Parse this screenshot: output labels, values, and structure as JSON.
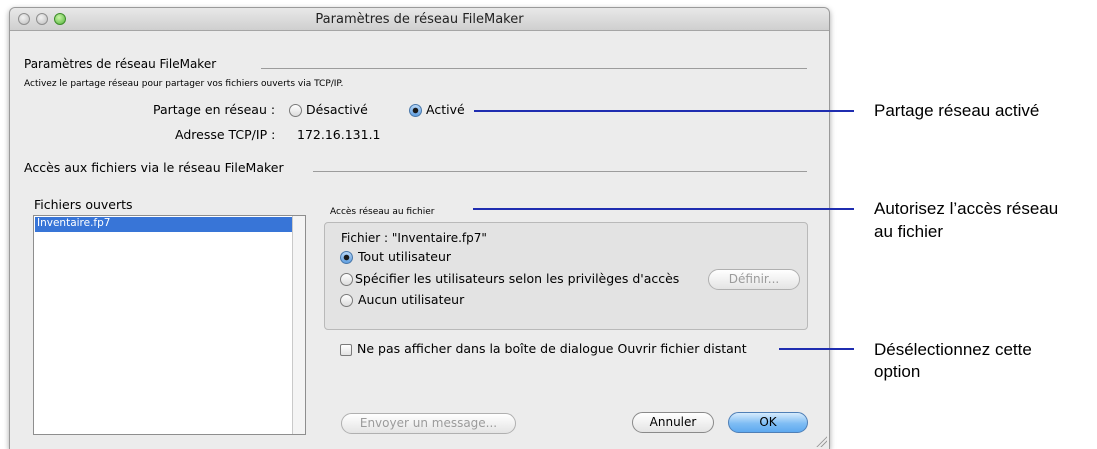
{
  "window": {
    "title": "Paramètres de réseau FileMaker"
  },
  "network": {
    "section_title": "Paramètres de réseau FileMaker",
    "description": "Activez le partage réseau pour partager vos fichiers ouverts via TCP/IP.",
    "sharing_label": "Partage en réseau :",
    "option_off": "Désactivé",
    "option_on": "Activé",
    "selected": "Activé",
    "tcpip_label": "Adresse TCP/IP :",
    "tcpip_value": "172.16.131.1"
  },
  "access": {
    "section_title": "Accès aux fichiers via le réseau FileMaker",
    "open_files_label": "Fichiers ouverts",
    "open_files": [
      "Inventaire.fp7"
    ],
    "file_access_label": "Accès réseau au fichier",
    "file_label": "Fichier : \"Inventaire.fp7\"",
    "options": [
      {
        "label": "Tout utilisateur",
        "selected": true
      },
      {
        "label": "Spécifier les utilisateurs selon les privilèges d'accès",
        "selected": false
      },
      {
        "label": "Aucun utilisateur",
        "selected": false
      }
    ],
    "define_button": "Définir...",
    "hide_checkbox_label": "Ne pas afficher dans la boîte de dialogue Ouvrir fichier distant",
    "hide_checked": false
  },
  "buttons": {
    "send_message": "Envoyer un message...",
    "cancel": "Annuler",
    "ok": "OK"
  },
  "callouts": {
    "sharing": "Partage réseau activé",
    "access_line1": "Autorisez l’accès réseau",
    "access_line2": "au fichier",
    "deselect_line1": "Désélectionnez cette",
    "deselect_line2": "option"
  },
  "colors": {
    "callout_line": "#1f2db0",
    "selection": "#3875d7",
    "default_button": "#5ea9ef"
  }
}
